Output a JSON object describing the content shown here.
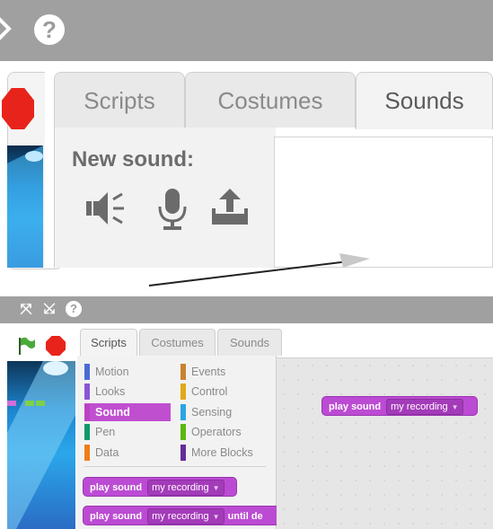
{
  "top_panel": {
    "tabs": [
      "Scripts",
      "Costumes",
      "Sounds"
    ],
    "active_tab": "Sounds",
    "new_sound_label": "New sound:",
    "icons": [
      "speaker-icon",
      "microphone-icon",
      "upload-icon"
    ]
  },
  "bottom_panel": {
    "tabs": [
      "Scripts",
      "Costumes",
      "Sounds"
    ],
    "active_tab": "Scripts",
    "categories_left": [
      {
        "label": "Motion",
        "color": "#4a6cd4"
      },
      {
        "label": "Looks",
        "color": "#8a55d7"
      },
      {
        "label": "Sound",
        "color": "#bb42c3"
      },
      {
        "label": "Pen",
        "color": "#0e9a6c"
      },
      {
        "label": "Data",
        "color": "#ee7d16"
      }
    ],
    "categories_right": [
      {
        "label": "Events",
        "color": "#c88330"
      },
      {
        "label": "Control",
        "color": "#e1a91a"
      },
      {
        "label": "Sensing",
        "color": "#2ca5e2"
      },
      {
        "label": "Operators",
        "color": "#5cb712"
      },
      {
        "label": "More Blocks",
        "color": "#632d99"
      }
    ],
    "selected_category": "Sound",
    "palette_blocks": [
      {
        "text": "play sound",
        "dropdown": "my recording",
        "suffix": ""
      },
      {
        "text": "play sound",
        "dropdown": "my recording",
        "suffix": "until de"
      }
    ],
    "canvas_block": {
      "text": "play sound",
      "dropdown": "my recording"
    }
  },
  "colors": {
    "titlebar": "#a0a0a0",
    "sound_block": "#bc4bd3",
    "stop_red": "#e8231b",
    "flag_green": "#4caa3a"
  }
}
